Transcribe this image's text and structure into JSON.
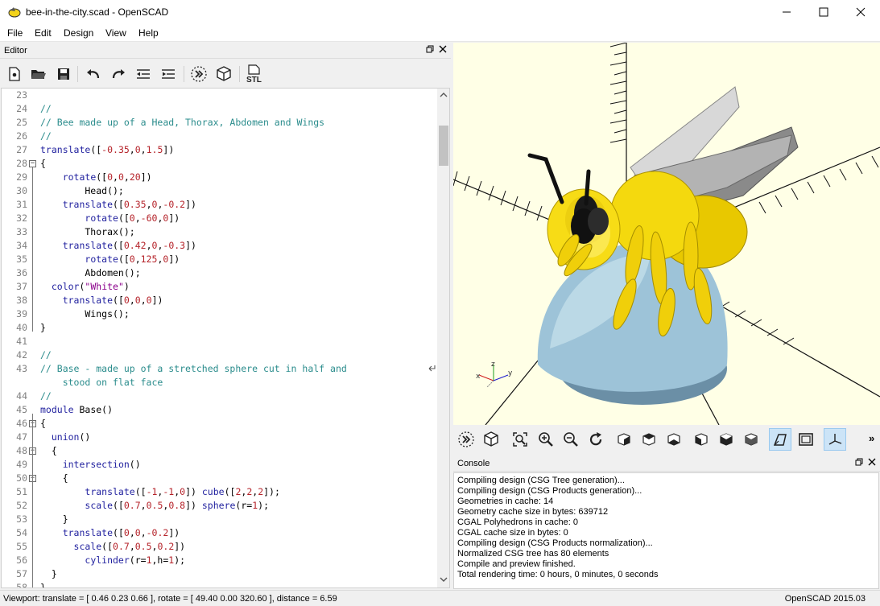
{
  "window": {
    "title": "bee-in-the-city.scad - OpenSCAD",
    "app_icon": "openscad-logo-icon"
  },
  "menu": [
    "File",
    "Edit",
    "Design",
    "View",
    "Help"
  ],
  "editor": {
    "title": "Editor",
    "toolbar": [
      "new-file-icon",
      "open-file-icon",
      "save-icon",
      "undo-icon",
      "redo-icon",
      "unindent-icon",
      "indent-icon",
      "preview-icon",
      "render-icon",
      "export-stl-icon"
    ],
    "stl_label": "STL",
    "lines": [
      {
        "n": "23",
        "t": ""
      },
      {
        "n": "24",
        "t": "//"
      },
      {
        "n": "25",
        "t": "// Bee made up of a Head, Thorax, Abdomen and Wings"
      },
      {
        "n": "26",
        "t": "//"
      },
      {
        "n": "27",
        "t": "translate([-0.35,0,1.5])"
      },
      {
        "n": "28",
        "t": "{"
      },
      {
        "n": "29",
        "t": "    rotate([0,0,20])"
      },
      {
        "n": "30",
        "t": "        Head();"
      },
      {
        "n": "31",
        "t": "    translate([0.35,0,-0.2])"
      },
      {
        "n": "32",
        "t": "        rotate([0,-60,0])"
      },
      {
        "n": "33",
        "t": "        Thorax();"
      },
      {
        "n": "34",
        "t": "    translate([0.42,0,-0.3])"
      },
      {
        "n": "35",
        "t": "        rotate([0,125,0])"
      },
      {
        "n": "36",
        "t": "        Abdomen();"
      },
      {
        "n": "37",
        "t": "  color(\"White\")"
      },
      {
        "n": "38",
        "t": "    translate([0,0,0])"
      },
      {
        "n": "39",
        "t": "        Wings();"
      },
      {
        "n": "40",
        "t": "}"
      },
      {
        "n": "41",
        "t": ""
      },
      {
        "n": "42",
        "t": "//"
      },
      {
        "n": "43",
        "t": "// Base - made up of a stretched sphere cut in half and"
      },
      {
        "n": "",
        "t": "    stood on flat face"
      },
      {
        "n": "44",
        "t": "//"
      },
      {
        "n": "45",
        "t": "module Base()"
      },
      {
        "n": "46",
        "t": "{"
      },
      {
        "n": "47",
        "t": "  union()"
      },
      {
        "n": "48",
        "t": "  {"
      },
      {
        "n": "49",
        "t": "    intersection()"
      },
      {
        "n": "50",
        "t": "    {"
      },
      {
        "n": "51",
        "t": "        translate([-1,-1,0]) cube([2,2,2]);"
      },
      {
        "n": "52",
        "t": "        scale([0.7,0.5,0.8]) sphere(r=1);"
      },
      {
        "n": "53",
        "t": "    }"
      },
      {
        "n": "54",
        "t": "    translate([0,0,-0.2])"
      },
      {
        "n": "55",
        "t": "      scale([0.7,0.5,0.2])"
      },
      {
        "n": "56",
        "t": "        cylinder(r=1,h=1);"
      },
      {
        "n": "57",
        "t": "  }"
      },
      {
        "n": "58",
        "t": "}"
      }
    ]
  },
  "viewport": {
    "axis_z_label": "z",
    "axis_x_label": "x",
    "axis_y_label": "y",
    "background": "#ffffe6"
  },
  "view_toolbar": [
    "preview-icon",
    "render-icon",
    "view-all-icon",
    "zoom-in-icon",
    "zoom-out-icon",
    "reset-view-icon",
    "view-right-icon",
    "view-top-icon",
    "view-bottom-icon",
    "view-left-icon",
    "view-front-icon",
    "view-back-icon",
    "perspective-icon",
    "orthogonal-icon",
    "show-axes-icon"
  ],
  "more_label": "»",
  "console": {
    "title": "Console",
    "lines": [
      "Compiling design (CSG Tree generation)...",
      "Compiling design (CSG Products generation)...",
      "Geometries in cache: 14",
      "Geometry cache size in bytes: 639712",
      "CGAL Polyhedrons in cache: 0",
      "CGAL cache size in bytes: 0",
      "Compiling design (CSG Products normalization)...",
      "Normalized CSG tree has 80 elements",
      "Compile and preview finished.",
      "Total rendering time: 0 hours, 0 minutes, 0 seconds"
    ]
  },
  "status": {
    "left": "Viewport: translate = [ 0.46 0.23 0.66 ], rotate = [ 49.40 0.00 320.60 ], distance = 6.59",
    "right": "OpenSCAD 2015.03"
  }
}
